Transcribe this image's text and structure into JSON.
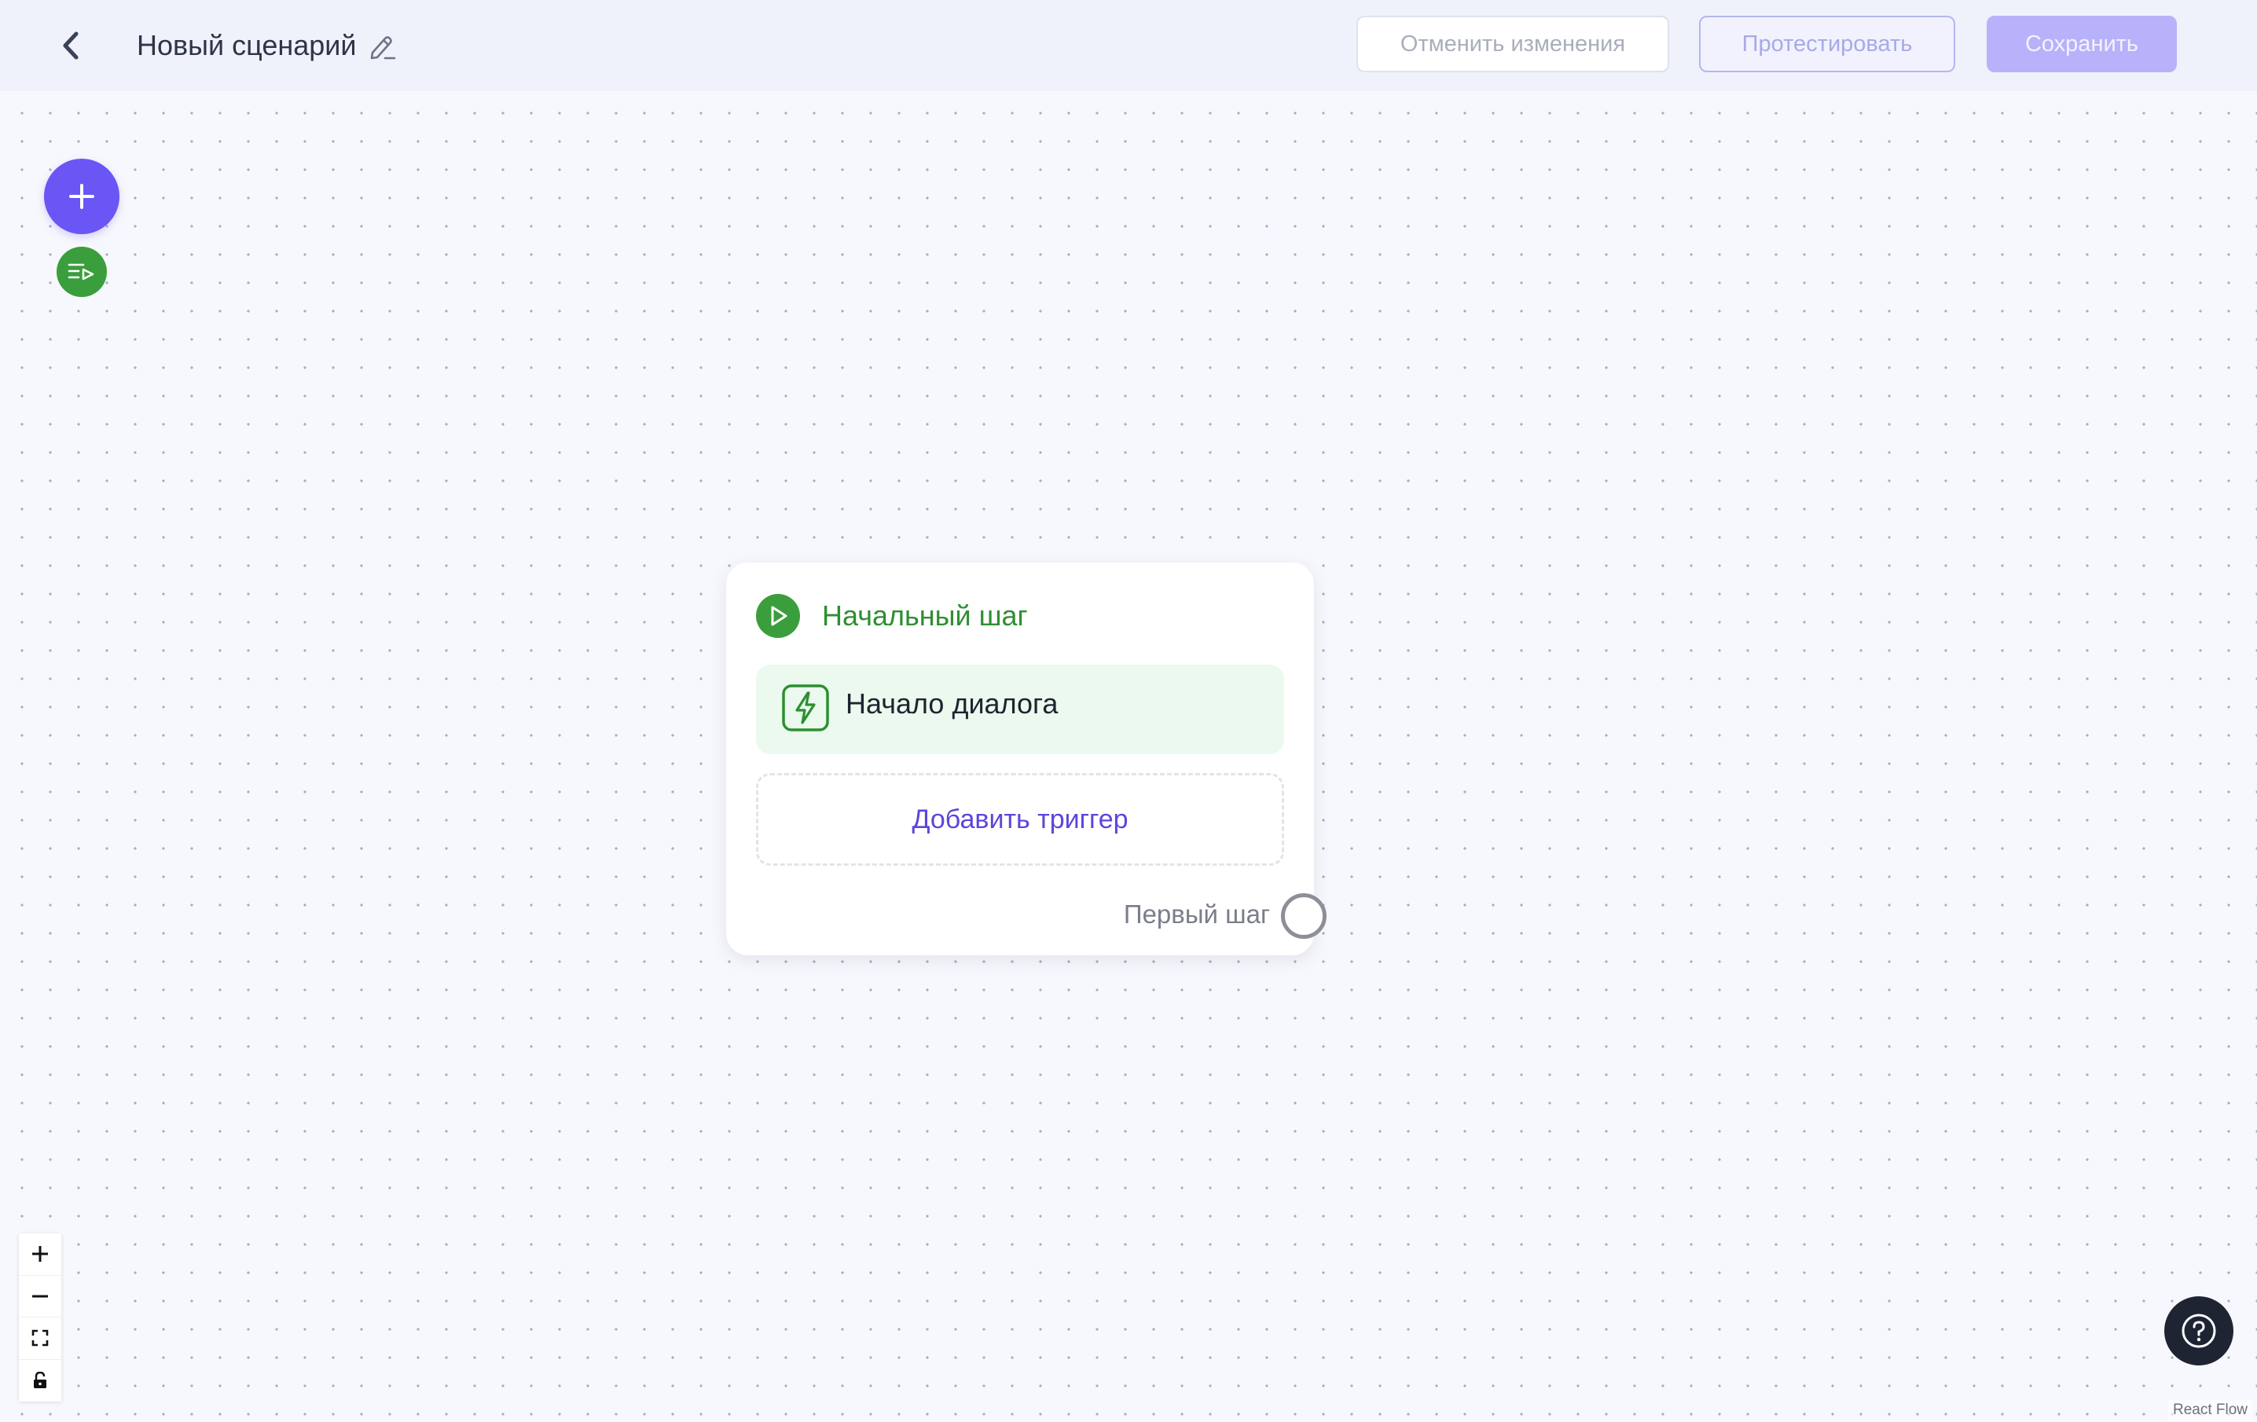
{
  "header": {
    "title": "Новый сценарий",
    "buttons": {
      "cancel": "Отменить изменения",
      "test": "Протестировать",
      "save": "Сохранить"
    }
  },
  "node": {
    "title": "Начальный шаг",
    "trigger_label": "Начало диалога",
    "add_trigger": "Добавить триггер",
    "first_step": "Первый шаг"
  },
  "icons": {
    "back": "chevron-left-icon",
    "edit": "pencil-icon",
    "add": "plus-icon",
    "list": "playlist-icon",
    "start": "play-icon",
    "trigger": "lightning-icon",
    "zoom_in": "plus-icon",
    "zoom_out": "minus-icon",
    "fit": "fit-view-icon",
    "lock": "lock-icon",
    "help": "question-icon"
  },
  "colors": {
    "accent": "#6a55f5",
    "success": "#3a9e3c",
    "trigger_bg": "#ebf9ee",
    "link": "#5b46dc",
    "help_bg": "#1f2433"
  },
  "attribution": "React Flow"
}
